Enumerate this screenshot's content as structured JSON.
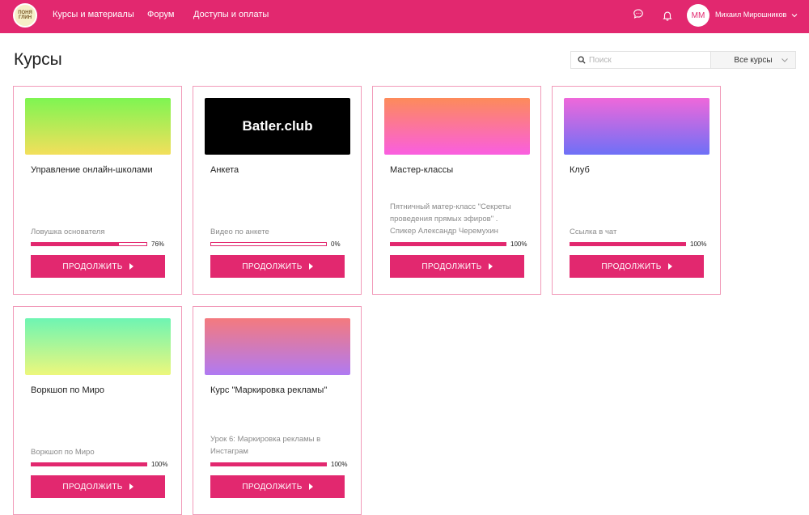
{
  "header": {
    "logo_text": "ПОНЯ ГЛИН",
    "nav": [
      "Курсы и материалы",
      "Форум",
      "Доступы и оплаты"
    ],
    "avatar_initials": "ММ",
    "user_name": "Михаил Мирошников"
  },
  "page": {
    "title": "Курсы",
    "search_placeholder": "Поиск",
    "filter_value": "Все курсы"
  },
  "courses": [
    {
      "title": "Управление онлайн-школами",
      "lesson": "Ловушка основателя",
      "progress": 0.76,
      "progress_label": "76%",
      "button": "ПРОДОЛЖИТЬ",
      "gradient": [
        "#7ef552",
        "#f3df5b"
      ]
    },
    {
      "title": "Анкета",
      "lesson": "Видео по анкете",
      "progress": 0,
      "progress_label": "0%",
      "button": "ПРОДОЛЖИТЬ",
      "thumb_text": "Batler.club"
    },
    {
      "title": "Мастер-классы",
      "lesson": "Пятничный матер-класс \"Секреты проведения прямых эфиров\" . Спикер Александр Черемухин",
      "progress": 1,
      "progress_label": "100%",
      "button": "ПРОДОЛЖИТЬ",
      "gradient": [
        "#fd8b5a",
        "#fa5ee0"
      ]
    },
    {
      "title": "Клуб",
      "lesson": "Ссылка в чат",
      "progress": 1,
      "progress_label": "100%",
      "button": "ПРОДОЛЖИТЬ",
      "gradient": [
        "#ef68da",
        "#6e70f6"
      ]
    },
    {
      "title": "Воркшоп по Миро",
      "lesson": "Воркшоп по Миро",
      "progress": 1,
      "progress_label": "100%",
      "button": "ПРОДОЛЖИТЬ",
      "gradient": [
        "#6ef5b3",
        "#ecf77c"
      ]
    },
    {
      "title": "Курс \"Маркировка рекламы\"",
      "lesson": "Урок 6: Маркировка рекламы в Инстаграм",
      "progress": 1,
      "progress_label": "100%",
      "button": "ПРОДОЛЖИТЬ",
      "gradient": [
        "#f47a7e",
        "#b07af2"
      ]
    }
  ]
}
